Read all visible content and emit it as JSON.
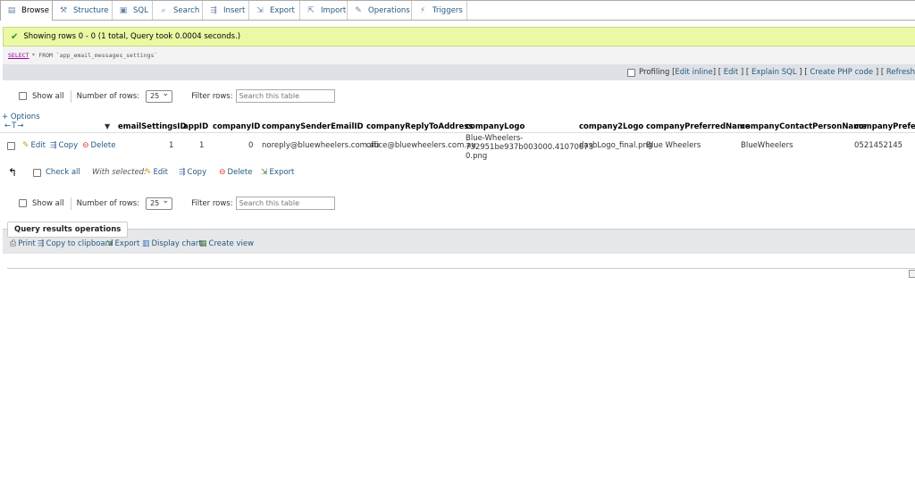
{
  "tabs": [
    {
      "label": "Browse",
      "icon": "browse-icon",
      "glyph": "▤"
    },
    {
      "label": "Structure",
      "icon": "structure-icon",
      "glyph": "⚒"
    },
    {
      "label": "SQL",
      "icon": "sql-icon",
      "glyph": "▣"
    },
    {
      "label": "Search",
      "icon": "search-icon",
      "glyph": "⌕"
    },
    {
      "label": "Insert",
      "icon": "insert-icon",
      "glyph": "⇶"
    },
    {
      "label": "Export",
      "icon": "export-icon",
      "glyph": "⇲"
    },
    {
      "label": "Import",
      "icon": "import-icon",
      "glyph": "⇱"
    },
    {
      "label": "Operations",
      "icon": "operations-icon",
      "glyph": "✎"
    },
    {
      "label": "Triggers",
      "icon": "triggers-icon",
      "glyph": "⚡"
    }
  ],
  "message": "Showing rows 0 - 0 (1 total, Query took 0.0004 seconds.)",
  "query": {
    "keyword": "SELECT",
    "rest": "* FROM `app_email_messages_settings`"
  },
  "profiling": {
    "label": "Profiling",
    "links": [
      "Edit inline",
      "Edit",
      "Explain SQL",
      "Create PHP code",
      "Refresh"
    ]
  },
  "nav": {
    "show_all": "Show all",
    "rows_label": "Number of rows:",
    "rows_value": "25",
    "filter_label": "Filter rows:",
    "filter_placeholder": "Search this table"
  },
  "options_label": "+ Options",
  "sort_arrows": "←T→",
  "columns": [
    "emailSettingsID",
    "appID",
    "companyID",
    "companySenderEmailID",
    "companyReplyToAddress",
    "companyLogo",
    "company2Logo",
    "companyPreferredName",
    "companyContactPersonName",
    "companyPreferredContact"
  ],
  "row": {
    "edit": "Edit",
    "copy": "Copy",
    "delete": "Delete",
    "emailSettingsID": "1",
    "appID": "1",
    "companyID": "0",
    "companySenderEmailID": "noreply@bluewheelers.com.au",
    "companyReplyToAddress": "office@bluewheelers.com.au",
    "companyLogo": [
      "Blue-Wheelers-",
      "732951be937b003000.41070673-",
      "0.png"
    ],
    "company2Logo": "dashLogo_final.png",
    "companyPreferredName": "Blue Wheelers",
    "companyContactPersonName": "BlueWheelers",
    "companyPreferredContact": "0521452145"
  },
  "bulk": {
    "check_all": "Check all",
    "with_selected": "With selected:",
    "edit": "Edit",
    "copy": "Copy",
    "delete": "Delete",
    "export": "Export"
  },
  "query_ops": {
    "title": "Query results operations",
    "print": "Print",
    "copy_clipboard": "Copy to clipboard",
    "export": "Export",
    "display_chart": "Display chart",
    "create_view": "Create view"
  },
  "colors": {
    "link": "#235a81",
    "success_bg": "#ebf8a4",
    "delete_red": "#d33"
  }
}
